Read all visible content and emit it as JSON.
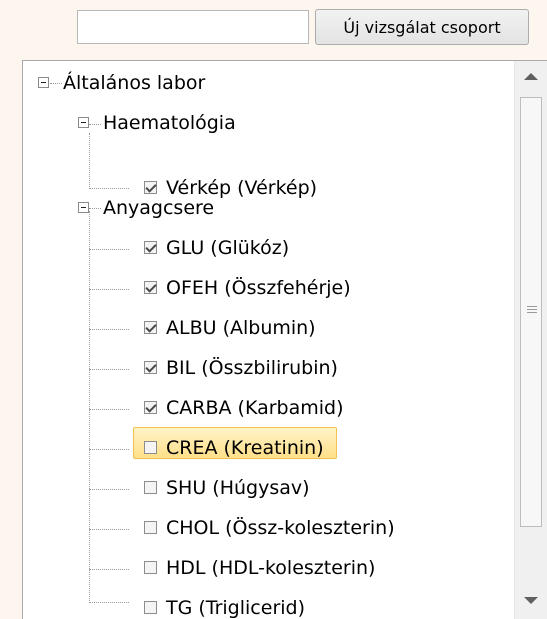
{
  "toolbar": {
    "search_value": "",
    "new_group_label": "Új vizsgálat csoport"
  },
  "tree": {
    "root": {
      "label": "Általános labor",
      "groups": [
        {
          "label": "Haematológia",
          "items": [
            {
              "label": "Vérkép (Vérkép)",
              "checked": true
            }
          ]
        },
        {
          "label": "Anyagcsere",
          "items": [
            {
              "label": "GLU (Glükóz)",
              "checked": true
            },
            {
              "label": "OFEH (Összfehérje)",
              "checked": true
            },
            {
              "label": "ALBU (Albumin)",
              "checked": true
            },
            {
              "label": "BIL (Összbilirubin)",
              "checked": true
            },
            {
              "label": "CARBA (Karbamid)",
              "checked": true
            },
            {
              "label": "CREA (Kreatinin)",
              "checked": false,
              "selected": true
            },
            {
              "label": "SHU (Húgysav)",
              "checked": false
            },
            {
              "label": "CHOL (Össz-koleszterin)",
              "checked": false
            },
            {
              "label": "HDL (HDL-koleszterin)",
              "checked": false
            },
            {
              "label": "TG (Triglicerid)",
              "checked": false
            }
          ]
        }
      ]
    }
  }
}
